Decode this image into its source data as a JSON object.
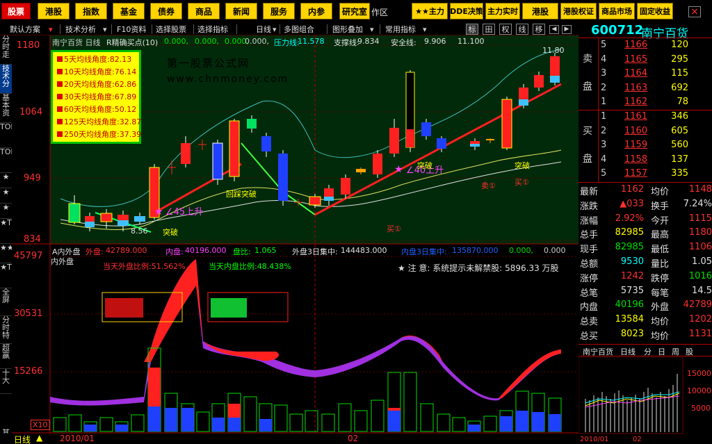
{
  "toolbar": {
    "buttons": [
      "股票",
      "港股",
      "指数",
      "基金",
      "债券",
      "商品",
      "新闻",
      "服务",
      "内参",
      "研究室",
      "作区",
      "★★主力",
      "DDE决策",
      "主力实时",
      "港股",
      "港股权证",
      "商品市场",
      "固定收益"
    ],
    "close": "×"
  },
  "nav": {
    "items": [
      "默认方案",
      "技术分析",
      "F10资料",
      "选择股票",
      "选择指标",
      "日线",
      "多图组合",
      "图形叠加",
      "常用指标"
    ],
    "tabs": [
      "标",
      "田",
      "权",
      "线",
      "移"
    ]
  },
  "left_tabs": [
    "分时走",
    "技术分",
    "基本资",
    "TOP",
    "TOP",
    "★",
    "★",
    "★",
    "★T",
    "★★",
    "★T",
    "全屏",
    "分时特",
    "超赢",
    "十大",
    "其"
  ],
  "chart": {
    "title": "南宁百货 日线",
    "indicator_name": "R精确买点(10)",
    "params": [
      "0.000,",
      "0.000,",
      "0.000,",
      "0.000,"
    ],
    "resistance_label": "压力线:",
    "resistance_val": "11.578",
    "support_label": "支撑线:",
    "support_val": "9.834",
    "safe_label": "安全线:",
    "safe_val": "9.906",
    "extra_val": "11.100",
    "y_labels": [
      "1180",
      "1064",
      "949",
      "834"
    ],
    "watermark1": "第一股票公式网",
    "watermark2": "www.chnmoney.com",
    "annot_high": "11.80",
    "annot_low": "8.56",
    "annot_angle1": "∠45上升",
    "annot_angle2": "∠40上升",
    "annot_break": "突破",
    "annot_pullback": "回踩突破",
    "annot_buy1": "买①",
    "annot_buy1b": "买①",
    "annot_sell1": "卖①",
    "annot_sell2": "买①"
  },
  "legend": [
    "5天均线角度:82.13",
    "10天均线角度:76.14",
    "20天均线角度:62.86",
    "30天均线角度:67.89",
    "60天均线角度:50.12",
    "125天均线角度:32.87",
    "250天均线角度:37.39"
  ],
  "lower": {
    "title": "A内外盘",
    "title2": "内外盘",
    "outer_label": "外盘:",
    "outer_val": "42789.000",
    "inner_label": "内盘:",
    "inner_val": "40196.000",
    "ratio_label": "盘比:",
    "ratio_val": "1.065",
    "outer3_label": "外盘3日集中:",
    "outer3_val": "144483.000",
    "inner3_label": "内盘3日集中:",
    "inner3_val": "135870.000",
    "z1": "0.000,",
    "z2": "0.000",
    "outer_ratio": "当天外盘比例:51.562%",
    "inner_ratio": "当天内盘比例:48.438%",
    "notice": "★ 注 意: 系统提示未解禁股: 5896.33 万股",
    "y_labels": [
      "45797",
      "30531",
      "15266"
    ],
    "x10": "X10"
  },
  "bottom": {
    "period": "日线",
    "date1": "2010/01",
    "date2": "02"
  },
  "right": {
    "code": "600712",
    "name": "南宁百货",
    "sell_label": "卖\n\n盘",
    "buy_label": "买\n\n盘",
    "asks": [
      {
        "lvl": "5",
        "price": "1166",
        "vol": "120"
      },
      {
        "lvl": "4",
        "price": "1165",
        "vol": "295"
      },
      {
        "lvl": "3",
        "price": "1164",
        "vol": "115"
      },
      {
        "lvl": "2",
        "price": "1163",
        "vol": "692"
      },
      {
        "lvl": "1",
        "price": "1162",
        "vol": "78"
      }
    ],
    "bids": [
      {
        "lvl": "1",
        "price": "1161",
        "vol": "346"
      },
      {
        "lvl": "2",
        "price": "1160",
        "vol": "605"
      },
      {
        "lvl": "3",
        "price": "1159",
        "vol": "560"
      },
      {
        "lvl": "4",
        "price": "1158",
        "vol": "137"
      },
      {
        "lvl": "5",
        "price": "1157",
        "vol": "335"
      }
    ],
    "stats": [
      {
        "k1": "最新",
        "v1": "1162",
        "k2": "均价",
        "v2": "1148"
      },
      {
        "k1": "涨跌",
        "v1": "▲033",
        "k2": "换手",
        "v2": "7.24%"
      },
      {
        "k1": "涨幅",
        "v1": "2.92%",
        "k2": "今开",
        "v2": "1115"
      },
      {
        "k1": "总手",
        "v1": "82985",
        "k2": "最高",
        "v2": "1180"
      },
      {
        "k1": "现手",
        "v1": "82985",
        "k2": "最低",
        "v2": "1106"
      },
      {
        "k1": "总额",
        "v1": "9530",
        "k2": "量比",
        "v2": "1.05"
      },
      {
        "k1": "涨停",
        "v1": "1242",
        "k2": "跌停",
        "v2": "1016"
      },
      {
        "k1": "总笔",
        "v1": "5735",
        "k2": "每笔",
        "v2": "14.5"
      },
      {
        "k1": "内盘",
        "v1": "40196",
        "k2": "外盘",
        "v2": "42789"
      },
      {
        "k1": "总卖",
        "v1": "13584",
        "k2": "均价",
        "v2": "1202"
      },
      {
        "k1": "总买",
        "v1": "8023",
        "k2": "均价",
        "v2": "1131"
      }
    ],
    "mini_tabs": [
      "南宁百货",
      "日线",
      "分",
      "日",
      "周",
      "股"
    ],
    "mini_y": [
      "15000",
      "10000",
      "5000"
    ],
    "mini_x1": "2010/01",
    "mini_x2": "02"
  },
  "colors": {
    "up": "#ff3030",
    "down": "#00e0e0",
    "accent": "#ffd400",
    "bg": "#000000"
  }
}
